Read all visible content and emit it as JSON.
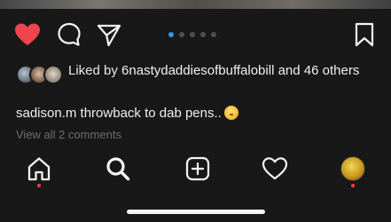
{
  "post": {
    "actions": {
      "like_icon": "heart-filled-icon",
      "comment_icon": "comment-bubble-icon",
      "share_icon": "paper-plane-icon",
      "save_icon": "bookmark-icon",
      "like_color": "#f0454e"
    },
    "carousel": {
      "total": 5,
      "active_index": 0,
      "active_color": "#3b8ff0"
    },
    "likes": {
      "prefix": "Liked by",
      "user": "6nastydaddiesofbuffalobill",
      "others": "and 46 others"
    },
    "caption": {
      "username": "sadison.m",
      "text": "throwback to dab pens..",
      "emoji": "face-with-hand-over-mouth-emoji"
    },
    "view_comments": "View all 2 comments"
  },
  "tab_bar": {
    "tabs": [
      {
        "name": "home",
        "icon": "home-icon",
        "has_notification": true
      },
      {
        "name": "search",
        "icon": "search-icon",
        "has_notification": false
      },
      {
        "name": "new-post",
        "icon": "plus-square-icon",
        "has_notification": false
      },
      {
        "name": "activity",
        "icon": "heart-outline-icon",
        "has_notification": false
      },
      {
        "name": "profile",
        "icon": "profile-avatar",
        "has_notification": true
      }
    ],
    "notification_color": "#ff3b46"
  }
}
